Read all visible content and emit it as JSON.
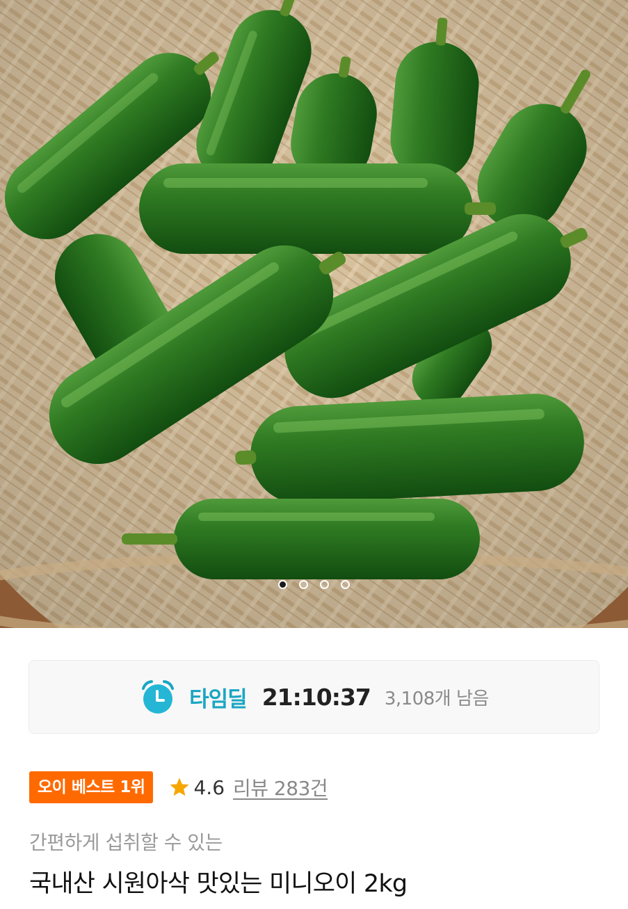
{
  "product_image": {
    "alt": "product-photo",
    "carousel": {
      "count": 4,
      "active_index": 0
    }
  },
  "time_deal": {
    "icon": "alarm-clock-icon",
    "label": "타임딜",
    "countdown": "21:10:37",
    "remaining": "3,108개 남음",
    "accent_color": "#1aa6c4"
  },
  "badge": {
    "text": "오이 베스트 1위",
    "color": "#ff6a00"
  },
  "rating": {
    "icon": "star-icon",
    "score": "4.6",
    "reviews": "리뷰 283건",
    "star_color": "#f7a600"
  },
  "product": {
    "subtitle": "간편하게 섭취할 수 있는",
    "title": "국내산 시원아삭 맛있는 미니오이 2kg"
  }
}
